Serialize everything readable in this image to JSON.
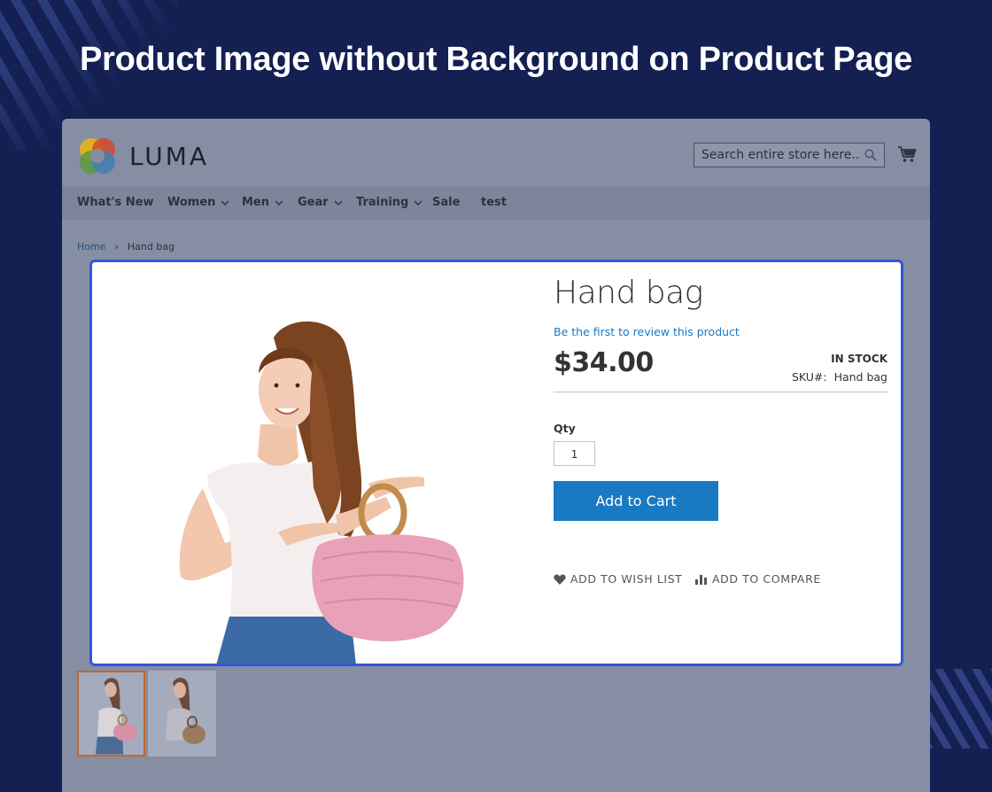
{
  "banner": {
    "title": "Product Image without Background on Product Page"
  },
  "header": {
    "logo_text": "LUMA",
    "search_placeholder": "Search entire store here...",
    "icons": {
      "search": "search-icon",
      "cart": "cart-icon"
    }
  },
  "nav": {
    "items": [
      {
        "label": "What's New",
        "dropdown": false
      },
      {
        "label": "Women",
        "dropdown": true
      },
      {
        "label": "Men",
        "dropdown": true
      },
      {
        "label": "Gear",
        "dropdown": true
      },
      {
        "label": "Training",
        "dropdown": true
      },
      {
        "label": "Sale",
        "dropdown": false
      },
      {
        "label": "test",
        "dropdown": false
      }
    ]
  },
  "breadcrumb": {
    "home": "Home",
    "current": "Hand bag"
  },
  "product": {
    "title": "Hand bag",
    "review_link": "Be the first to review this product",
    "price": "$34.00",
    "stock": "IN STOCK",
    "sku_label": "SKU#:",
    "sku_value": "Hand bag",
    "qty_label": "Qty",
    "qty_value": "1",
    "add_to_cart": "Add to Cart",
    "wishlist": "ADD TO WISH LIST",
    "compare": "ADD TO COMPARE"
  },
  "colors": {
    "accent": "#1979c3",
    "highlight_border": "#3256d8",
    "thumb_active": "#c6652a",
    "banner_bg": "#141f52"
  }
}
